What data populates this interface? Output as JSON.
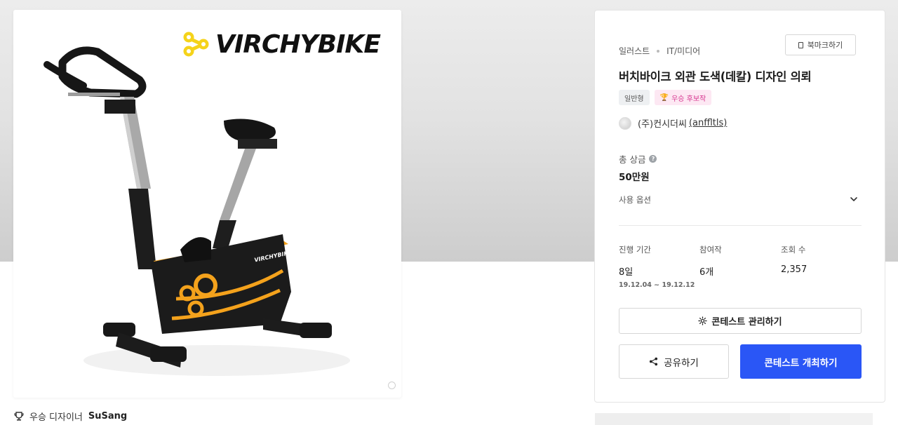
{
  "image_card": {
    "logo_text": "VIRCHYBIKE",
    "bike_brand_text": "VIRCHYBIKE",
    "winner_prefix": "우승 디자이너",
    "winner_name": "SuSang"
  },
  "panel": {
    "breadcrumb": [
      "일러스트",
      "IT/미디어"
    ],
    "bookmark_label": "북마크하기",
    "title": "버치바이크 외관 도색(데칼) 디자인 의뢰",
    "tags": [
      "일반형",
      "우승 후보작"
    ],
    "host_name": "(주)컨시더씨",
    "host_handle": "(anffltls)",
    "prize_label": "총 상금",
    "prize_value": "50만원",
    "usage_label": "사용 옵션",
    "stats": [
      {
        "label": "진행 기간",
        "value": "8일",
        "sub": "19.12.04 ~ 19.12.12"
      },
      {
        "label": "참여작",
        "value": "6개",
        "sub": ""
      },
      {
        "label": "조회 수",
        "value": "2,357",
        "sub": ""
      }
    ],
    "manage_label": "콘테스트 관리하기",
    "share_label": "공유하기",
    "host_contest_label": "콘테스트 개최하기"
  },
  "colors": {
    "primary_button": "#2a56f6",
    "logo_yellow": "#f5d31a",
    "bike_orange": "#f4a21c",
    "candidate_pink": "#d6358f"
  }
}
